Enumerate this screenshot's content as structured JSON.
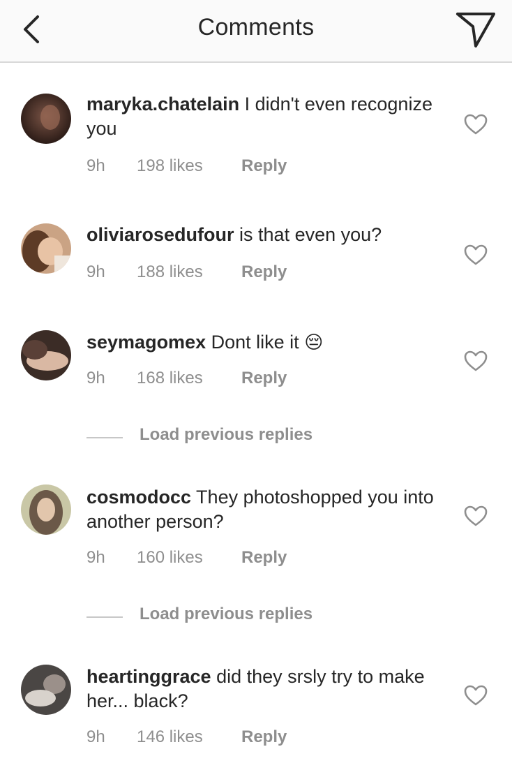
{
  "header": {
    "title": "Comments",
    "back_icon": "chevron-left-icon",
    "send_icon": "paper-plane-icon"
  },
  "comments": [
    {
      "username": "maryka.chatelain",
      "text": " I didn't even recognize you",
      "time": "9h",
      "likes": "198 likes",
      "reply": "Reply"
    },
    {
      "username": "oliviarosedufour",
      "text": " is that even you?",
      "time": "9h",
      "likes": "188 likes",
      "reply": "Reply"
    },
    {
      "username": "seymagomex",
      "text": " Dont like it",
      "emoji": "😔",
      "time": "9h",
      "likes": "168 likes",
      "reply": "Reply"
    },
    {
      "username": "cosmodocc",
      "text": " They photoshopped you into another person?",
      "time": "9h",
      "likes": "160 likes",
      "reply": "Reply"
    },
    {
      "username": "heartinggrace",
      "text": " did they srsly try to make her... black?",
      "time": "9h",
      "likes": "146 likes",
      "reply": "Reply"
    }
  ],
  "load_previous": [
    "Load previous replies",
    "Load previous replies"
  ],
  "colors": {
    "text": "#262626",
    "muted": "#8e8e8e",
    "header_bg": "#fafafa",
    "divider": "#d8d8d8"
  }
}
